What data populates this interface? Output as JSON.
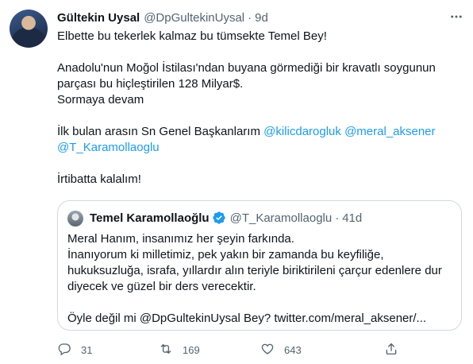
{
  "tweet": {
    "author_name": "Gültekin Uysal",
    "author_handle": "@DpGultekinUysal",
    "separator": "·",
    "time": "9d",
    "lines": [
      "Elbette bu tekerlek kalmaz bu tümsekte Temel Bey!",
      "Anadolu'nun Moğol İstilası'ndan buyana görmediği bir kravatlı soygunun",
      "parçası bu hiçleştirilen 128 Milyar$.",
      "Sormaya devam",
      "İlk bulan arasın Sn Genel Başkanlarım",
      "İrtibatta kalalım!"
    ],
    "mentions": [
      "@kilicdarogluk",
      "@meral_aksener",
      "@T_Karamollaoglu"
    ]
  },
  "quote": {
    "author_name": "Temel Karamollaoğlu",
    "author_handle": "@T_Karamollaoglu",
    "separator": "·",
    "time": "41d",
    "lines": [
      "Meral Hanım, insanımız her şeyin farkında.",
      "İnanıyorum ki milletimiz, pek yakın bir zamanda bu keyfiliğe,",
      "hukuksuzluğa, israfa, yıllardır alın teriyle biriktirileni çarçur edenlere dur",
      "diyecek ve güzel bir ders verecektir.",
      "Öyle değil mi @DpGultekinUysal Bey? twitter.com/meral_aksener/..."
    ]
  },
  "actions": {
    "reply_count": "31",
    "retweet_count": "169",
    "like_count": "643"
  },
  "colors": {
    "link": "#1d9bf0",
    "secondary": "#536471",
    "border": "#cfd9de",
    "verified": "#1d9bf0"
  },
  "icons": [
    "more-icon",
    "verified-badge-icon",
    "reply-icon",
    "retweet-icon",
    "like-icon",
    "share-icon"
  ]
}
